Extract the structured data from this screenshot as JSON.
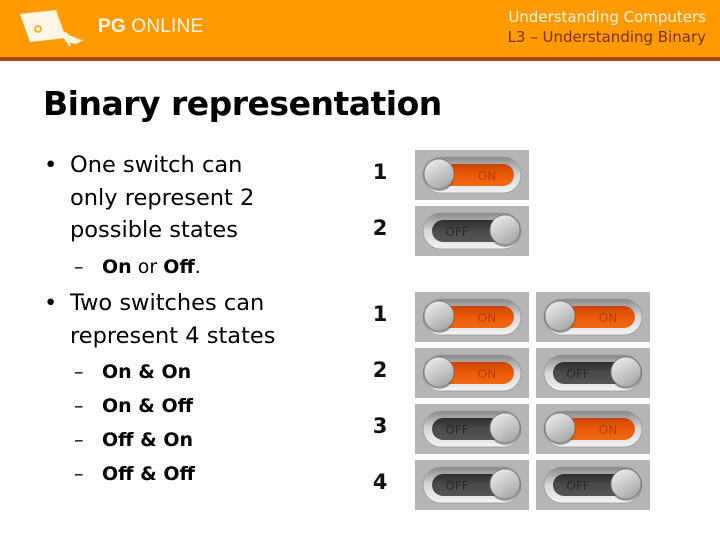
{
  "header": {
    "brand_bold": "PG",
    "brand_light": "ONLINE",
    "course_title": "Understanding Computers",
    "lesson_title": "L3 – Understanding Binary",
    "colors": {
      "bar": "#ff9a00",
      "rule": "#a8470f"
    }
  },
  "slide": {
    "title": "Binary representation",
    "bullets": [
      {
        "text_lines": [
          "One switch can",
          "only represent 2",
          "possible states"
        ],
        "sub": [
          {
            "parts": [
              {
                "t": "On",
                "b": true
              },
              {
                "t": " or ",
                "b": false
              },
              {
                "t": "Off",
                "b": true
              },
              {
                "t": ".",
                "b": false
              }
            ]
          }
        ]
      },
      {
        "text_lines": [
          "Two switches can",
          "represent 4 states"
        ],
        "sub": [
          {
            "text": "On & On"
          },
          {
            "text": "On & Off"
          },
          {
            "text": "Off & On"
          },
          {
            "text": "Off & Off"
          }
        ]
      }
    ],
    "dash": "–",
    "bullet_glyph": "•"
  },
  "switch_labels": {
    "on": "ON",
    "off": "OFF"
  },
  "one_switch": {
    "rows": [
      {
        "number": "1",
        "switches": [
          "on"
        ]
      },
      {
        "number": "2",
        "switches": [
          "off"
        ]
      }
    ]
  },
  "two_switches": {
    "rows": [
      {
        "number": "1",
        "switches": [
          "on",
          "on"
        ]
      },
      {
        "number": "2",
        "switches": [
          "on",
          "off"
        ]
      },
      {
        "number": "3",
        "switches": [
          "off",
          "on"
        ]
      },
      {
        "number": "4",
        "switches": [
          "off",
          "off"
        ]
      }
    ]
  },
  "colors": {
    "on": "#ee5a08",
    "off": "#4a4a4a",
    "tile": "#b5b5b5"
  }
}
